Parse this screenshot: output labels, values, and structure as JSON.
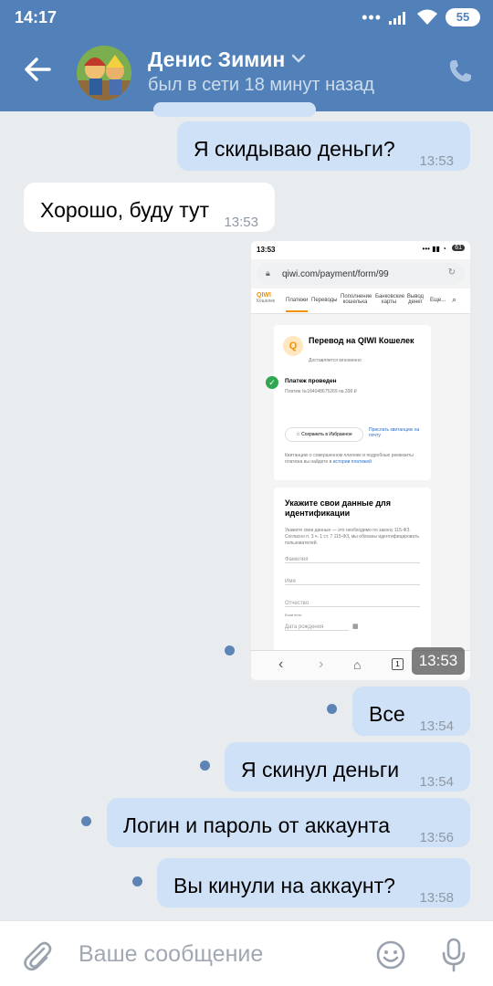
{
  "status_bar": {
    "time": "14:17",
    "battery": "55"
  },
  "header": {
    "contact_name": "Денис Зимин",
    "presence": "был в сети 18 минут назад",
    "icons": [
      "back-arrow-icon",
      "chevron-down-icon",
      "phone-icon"
    ],
    "accent_color": "#5181b8"
  },
  "messages": [
    {
      "dir": "out",
      "text": "Я скидываю деньги?",
      "time": "13:53",
      "unread": false
    },
    {
      "dir": "in",
      "text": "Хорошо, буду тут",
      "time": "13:53"
    },
    {
      "dir": "out",
      "type": "image",
      "time": "13:53",
      "unread": true
    },
    {
      "dir": "out",
      "text": "Все",
      "time": "13:54",
      "unread": true
    },
    {
      "dir": "out",
      "text": "Я скинул деньги",
      "time": "13:54",
      "unread": true
    },
    {
      "dir": "out",
      "text": "Логин и пароль от аккаунта",
      "time": "13:56",
      "unread": true
    },
    {
      "dir": "out",
      "text": "Вы кинули на аккаунт?",
      "time": "13:58",
      "unread": true
    }
  ],
  "attachment": {
    "status_time": "13:53",
    "battery": "61",
    "url": "qiwi.com/payment/form/99",
    "logo_text": "QIWI",
    "logo_sub": "Кошелек",
    "nav": [
      "Платежи",
      "Переводы",
      "Пополнение кошелька",
      "Банковские карты",
      "Вывод денег",
      "Еще..."
    ],
    "title": "Перевод на QIWI Кошелек",
    "subtitle": "Доставляется мгновенно",
    "status": "Платеж проведен",
    "payment_line": "Платеж №184048675269 на 399 ₽",
    "save_fav": "Сохранить в Избранное",
    "send_receipt": "Прислать квитанцию на почту",
    "receipt_note": "Квитанцию о совершенном платеже и подробные реквизиты платежа вы найдете в",
    "history_link": "истории платежей",
    "ident_title": "Укажите свои данные для идентификации",
    "ident_note": "Укажите свои данные — это необходимо по закону 115-ФЗ. Согласно п. 3 ч. 1 ст. 7 115-ФЗ, мы обязаны идентифицировать пользователей.",
    "fields": [
      "Фамилия",
      "Имя",
      "Отчество",
      "Дата рождения"
    ],
    "field_hint": "Если есть"
  },
  "composer": {
    "placeholder": "Ваше сообщение"
  }
}
